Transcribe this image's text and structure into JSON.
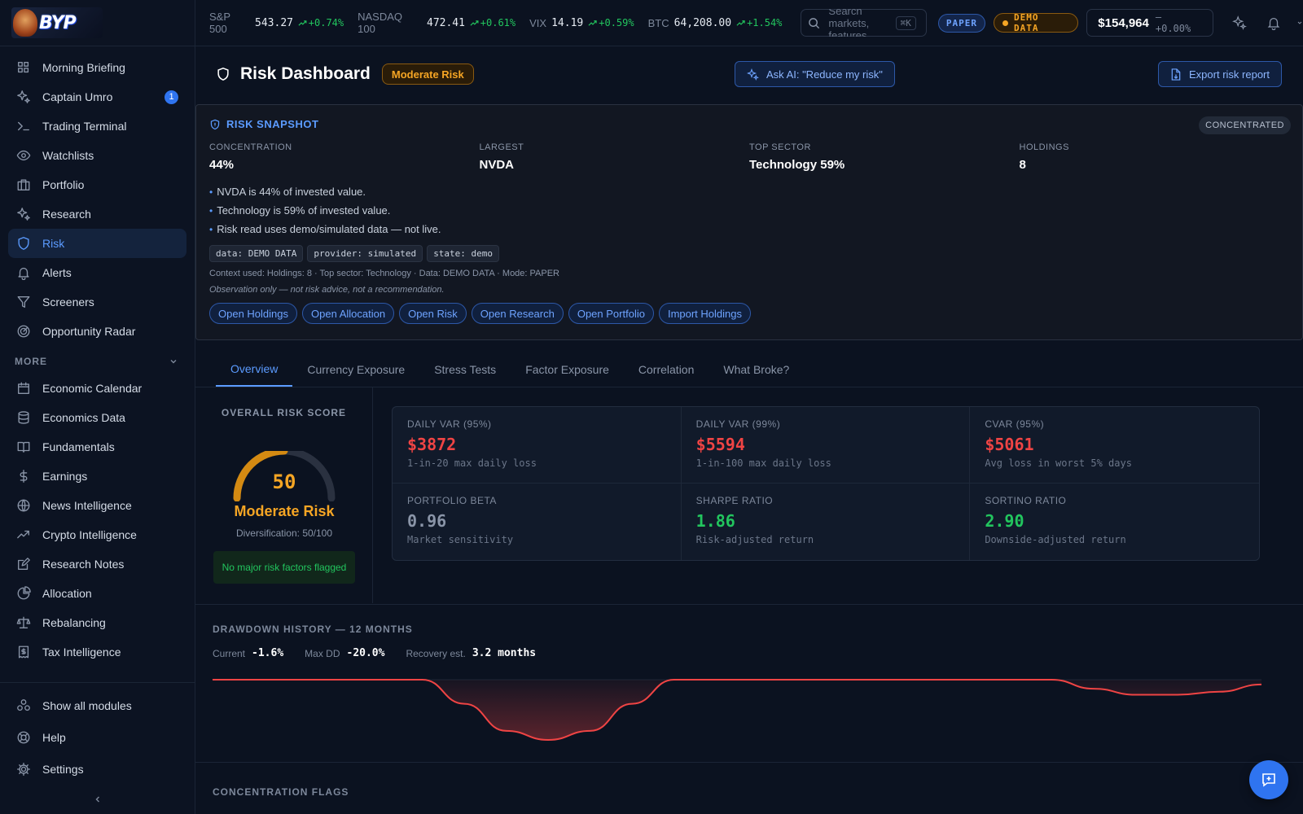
{
  "logo": {
    "text": "BYP"
  },
  "sidebar": {
    "items": [
      {
        "label": "Morning Briefing",
        "icon": "grid-icon"
      },
      {
        "label": "Captain Umro",
        "icon": "sparkle-icon",
        "badge": "1"
      },
      {
        "label": "Trading Terminal",
        "icon": "terminal-icon"
      },
      {
        "label": "Watchlists",
        "icon": "eye-icon"
      },
      {
        "label": "Portfolio",
        "icon": "briefcase-icon"
      },
      {
        "label": "Research",
        "icon": "sparkle-icon"
      },
      {
        "label": "Risk",
        "icon": "shield-icon",
        "active": true
      },
      {
        "label": "Alerts",
        "icon": "bell-icon"
      },
      {
        "label": "Screeners",
        "icon": "filter-icon"
      },
      {
        "label": "Opportunity Radar",
        "icon": "radar-icon"
      }
    ],
    "more_label": "MORE",
    "more_items": [
      {
        "label": "Economic Calendar",
        "icon": "calendar-icon"
      },
      {
        "label": "Economics Data",
        "icon": "database-icon"
      },
      {
        "label": "Fundamentals",
        "icon": "book-icon"
      },
      {
        "label": "Earnings",
        "icon": "dollar-icon"
      },
      {
        "label": "News Intelligence",
        "icon": "globe-icon"
      },
      {
        "label": "Crypto Intelligence",
        "icon": "trend-icon"
      },
      {
        "label": "Research Notes",
        "icon": "edit-icon"
      },
      {
        "label": "Allocation",
        "icon": "pie-icon"
      },
      {
        "label": "Rebalancing",
        "icon": "scale-icon"
      },
      {
        "label": "Tax Intelligence",
        "icon": "receipt-icon"
      }
    ],
    "footer": [
      {
        "label": "Show all modules",
        "icon": "modules-icon"
      },
      {
        "label": "Help",
        "icon": "lifebuoy-icon"
      },
      {
        "label": "Settings",
        "icon": "gear-icon"
      }
    ]
  },
  "topbar": {
    "tickers": [
      {
        "symbol": "S&P 500",
        "price": "543.27",
        "change": "+0.74%"
      },
      {
        "symbol": "NASDAQ 100",
        "price": "472.41",
        "change": "+0.61%"
      },
      {
        "symbol": "VIX",
        "price": "14.19",
        "change": "+0.59%"
      },
      {
        "symbol": "BTC",
        "price": "64,208.00",
        "change": "+1.54%"
      }
    ],
    "search_placeholder": "Search markets, features...",
    "search_shortcut": "⌘K",
    "paper": "PAPER",
    "demo": "DEMO DATA",
    "balance": "$154,964",
    "balance_change": "— +0.00%"
  },
  "header": {
    "title": "Risk Dashboard",
    "risk_pill": "Moderate Risk",
    "ask_ai": "Ask AI: \"Reduce my risk\"",
    "export": "Export risk report"
  },
  "snapshot": {
    "title": "RISK SNAPSHOT",
    "pill": "CONCENTRATED",
    "stats": [
      {
        "label": "CONCENTRATION",
        "value": "44%"
      },
      {
        "label": "LARGEST",
        "value": "NVDA"
      },
      {
        "label": "TOP SECTOR",
        "value": "Technology 59%"
      },
      {
        "label": "HOLDINGS",
        "value": "8"
      }
    ],
    "bullets": [
      "NVDA is 44% of invested value.",
      "Technology is 59% of invested value.",
      "Risk read uses demo/simulated data — not live."
    ],
    "tags": [
      "data: DEMO DATA",
      "provider: simulated",
      "state: demo"
    ],
    "context": "Context used: Holdings: 8 · Top sector: Technology · Data: DEMO DATA · Mode: PAPER",
    "observation": "Observation only — not risk advice, not a recommendation.",
    "links": [
      "Open Holdings",
      "Open Allocation",
      "Open Risk",
      "Open Research",
      "Open Portfolio",
      "Import Holdings"
    ]
  },
  "tabs": [
    "Overview",
    "Currency Exposure",
    "Stress Tests",
    "Factor Exposure",
    "Correlation",
    "What Broke?"
  ],
  "score": {
    "heading": "OVERALL RISK SCORE",
    "value": "50",
    "fraction": 0.5,
    "label": "Moderate Risk",
    "diversification": "Diversification: 50/100",
    "flag_text": "No major risk factors flagged",
    "color": "#f5a524"
  },
  "metrics": [
    {
      "label": "DAILY VAR (95%)",
      "value": "$3872",
      "sub": "1-in-20 max daily loss",
      "tone": "red"
    },
    {
      "label": "DAILY VAR (99%)",
      "value": "$5594",
      "sub": "1-in-100 max daily loss",
      "tone": "red"
    },
    {
      "label": "CVAR (95%)",
      "value": "$5061",
      "sub": "Avg loss in worst 5% days",
      "tone": "red"
    },
    {
      "label": "PORTFOLIO BETA",
      "value": "0.96",
      "sub": "Market sensitivity",
      "tone": "gray"
    },
    {
      "label": "SHARPE RATIO",
      "value": "1.86",
      "sub": "Risk-adjusted return",
      "tone": "green"
    },
    {
      "label": "SORTINO RATIO",
      "value": "2.90",
      "sub": "Downside-adjusted return",
      "tone": "green"
    }
  ],
  "drawdown": {
    "heading": "DRAWDOWN HISTORY — 12 MONTHS",
    "current_label": "Current",
    "current": "-1.6%",
    "max_label": "Max DD",
    "max": "-20.0%",
    "recovery_label": "Recovery est.",
    "recovery": "3.2 months"
  },
  "chart_data": {
    "type": "area",
    "x": [
      0,
      1,
      2,
      3,
      4,
      5,
      6,
      7,
      8,
      9,
      10,
      11,
      12,
      13,
      14,
      15,
      16,
      17,
      18,
      19,
      20,
      21,
      22,
      23,
      24,
      25
    ],
    "values": [
      0,
      0,
      0,
      0,
      0,
      0,
      -8,
      -17,
      -20,
      -17,
      -8,
      0,
      0,
      0,
      0,
      0,
      0,
      0,
      0,
      0,
      0,
      -3,
      -5,
      -5,
      -4,
      -1.6
    ],
    "ylim": [
      -20,
      0
    ],
    "color": "#ef4444"
  },
  "concentration_heading": "CONCENTRATION FLAGS"
}
